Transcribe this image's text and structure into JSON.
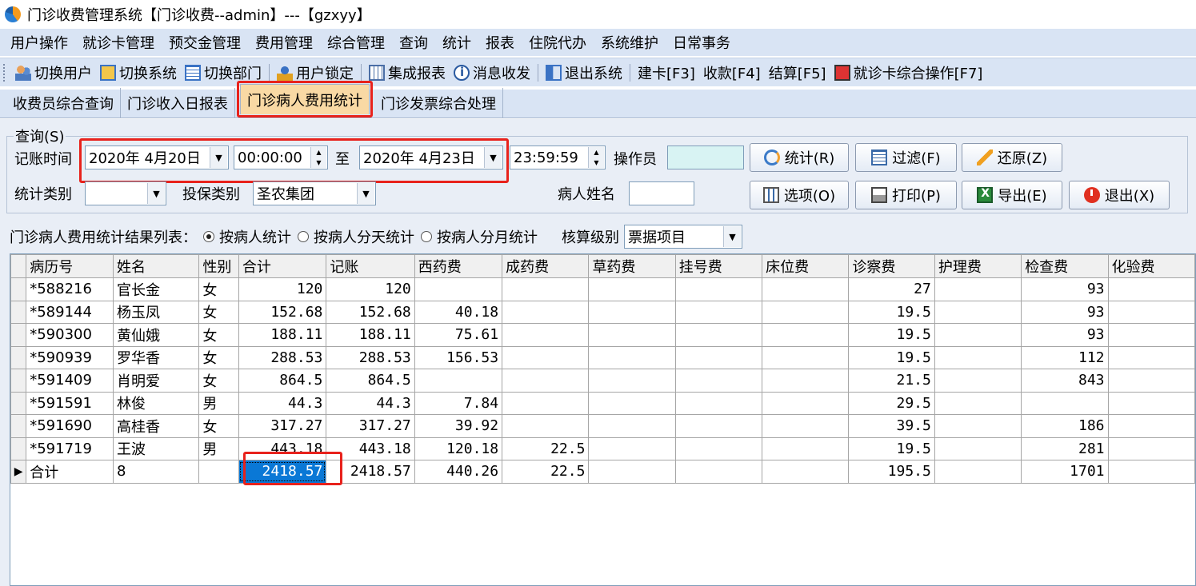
{
  "window": {
    "title": "门诊收费管理系统【门诊收费--admin】---【gzxyy】"
  },
  "menu": [
    "用户操作",
    "就诊卡管理",
    "预交金管理",
    "费用管理",
    "综合管理",
    "查询",
    "统计",
    "报表",
    "住院代办",
    "系统维护",
    "日常事务"
  ],
  "toolbar": {
    "switch_user": "切换用户",
    "switch_system": "切换系统",
    "switch_dept": "切换部门",
    "lock_user": "用户锁定",
    "integrated_report": "集成报表",
    "messages": "消息收发",
    "exit_system": "退出系统",
    "build_card": "建卡[F3]",
    "collect": "收款[F4]",
    "settle": "结算[F5]",
    "card_ops": "就诊卡综合操作[F7]"
  },
  "tabs": [
    "收费员综合查询",
    "门诊收入日报表",
    "门诊病人费用统计",
    "门诊发票综合处理"
  ],
  "query": {
    "legend": "查询(S)",
    "time_label": "记账时间",
    "date_from": "2020年  4月20日",
    "time_from": "00:00:00",
    "to_label": "至",
    "date_to": "2020年  4月23日",
    "time_to": "23:59:59",
    "operator_label": "操作员",
    "operator_value": "",
    "stat_type_label": "统计类别",
    "stat_type_value": "",
    "insurance_label": "投保类别",
    "insurance_value": "圣农集团",
    "patient_name_label": "病人姓名",
    "patient_name_value": "",
    "buttons": {
      "stat": "统计(R)",
      "filter": "过滤(F)",
      "restore": "还原(Z)",
      "options": "选项(O)",
      "print": "打印(P)",
      "export": "导出(E)",
      "exit": "退出(X)"
    }
  },
  "result": {
    "title": "门诊病人费用统计结果列表：",
    "radio_by_patient": "按病人统计",
    "radio_by_day": "按病人分天统计",
    "radio_by_month": "按病人分月统计",
    "level_label": "核算级别",
    "level_value": "票据项目"
  },
  "grid": {
    "columns": [
      "病历号",
      "姓名",
      "性别",
      "合计",
      "记账",
      "西药费",
      "成药费",
      "草药费",
      "挂号费",
      "床位费",
      "诊察费",
      "护理费",
      "检查费",
      "化验费"
    ],
    "rows": [
      [
        "*588216",
        "官长金",
        "女",
        "120",
        "120",
        "",
        "",
        "",
        "",
        "",
        "27",
        "",
        "93",
        ""
      ],
      [
        "*589144",
        "杨玉凤",
        "女",
        "152.68",
        "152.68",
        "40.18",
        "",
        "",
        "",
        "",
        "19.5",
        "",
        "93",
        ""
      ],
      [
        "*590300",
        "黄仙娥",
        "女",
        "188.11",
        "188.11",
        "75.61",
        "",
        "",
        "",
        "",
        "19.5",
        "",
        "93",
        ""
      ],
      [
        "*590939",
        "罗华香",
        "女",
        "288.53",
        "288.53",
        "156.53",
        "",
        "",
        "",
        "",
        "19.5",
        "",
        "112",
        ""
      ],
      [
        "*591409",
        "肖明爱",
        "女",
        "864.5",
        "864.5",
        "",
        "",
        "",
        "",
        "",
        "21.5",
        "",
        "843",
        ""
      ],
      [
        "*591591",
        "林俊",
        "男",
        "44.3",
        "44.3",
        "7.84",
        "",
        "",
        "",
        "",
        "29.5",
        "",
        "",
        ""
      ],
      [
        "*591690",
        "高桂香",
        "女",
        "317.27",
        "317.27",
        "39.92",
        "",
        "",
        "",
        "",
        "39.5",
        "",
        "186",
        ""
      ],
      [
        "*591719",
        "王波",
        "男",
        "443.18",
        "443.18",
        "120.18",
        "22.5",
        "",
        "",
        "",
        "19.5",
        "",
        "281",
        ""
      ],
      [
        "合计",
        "8",
        "",
        "2418.57",
        "2418.57",
        "440.26",
        "22.5",
        "",
        "",
        "",
        "195.5",
        "",
        "1701",
        ""
      ]
    ]
  },
  "colors": {
    "accent_red": "#e8221c",
    "selection": "#0a78d6",
    "toolbar_bg": "#d9e4f4",
    "active_tab": "#f9d9a4"
  }
}
